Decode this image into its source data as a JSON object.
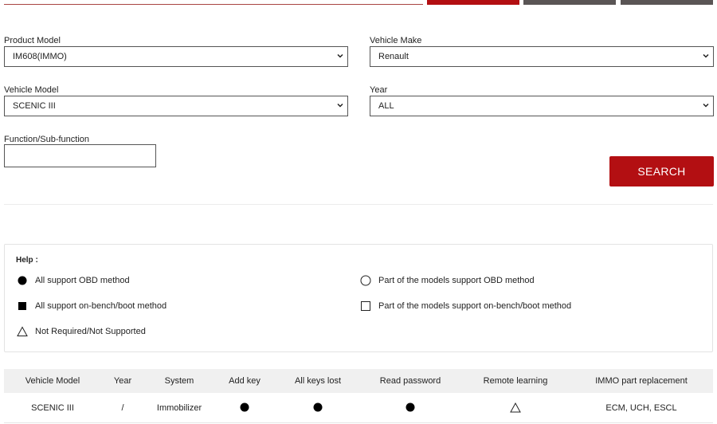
{
  "form": {
    "product_model": {
      "label": "Product Model",
      "value": "IM608(IMMO)"
    },
    "vehicle_make": {
      "label": "Vehicle Make",
      "value": "Renault"
    },
    "vehicle_model": {
      "label": "Vehicle Model",
      "value": "SCENIC III"
    },
    "year": {
      "label": "Year",
      "value": "ALL"
    },
    "function": {
      "label": "Function/Sub-function",
      "value": ""
    },
    "search_label": "SEARCH"
  },
  "help": {
    "title": "Help :",
    "items": [
      {
        "icon": "filled-circle-icon",
        "text": "All support OBD method"
      },
      {
        "icon": "hollow-circle-icon",
        "text": "Part of the models support OBD method"
      },
      {
        "icon": "filled-square-icon",
        "text": "All support on-bench/boot method"
      },
      {
        "icon": "hollow-square-icon",
        "text": "Part of the models support on-bench/boot method"
      },
      {
        "icon": "triangle-icon",
        "text": "Not Required/Not Supported"
      }
    ]
  },
  "table": {
    "headers": [
      "Vehicle Model",
      "Year",
      "System",
      "Add key",
      "All keys lost",
      "Read password",
      "Remote learning",
      "IMMO part replacement"
    ],
    "rows": [
      {
        "vehicle_model": "SCENIC III",
        "year": "/",
        "system": "Immobilizer",
        "add_key": "filled-circle-icon",
        "all_keys_lost": "filled-circle-icon",
        "read_password": "filled-circle-icon",
        "remote_learning": "triangle-icon",
        "immo_part_replacement": "ECM, UCH, ESCL"
      }
    ]
  },
  "colors": {
    "accent": "#b30f12",
    "tab_gray": "#5a5555"
  }
}
